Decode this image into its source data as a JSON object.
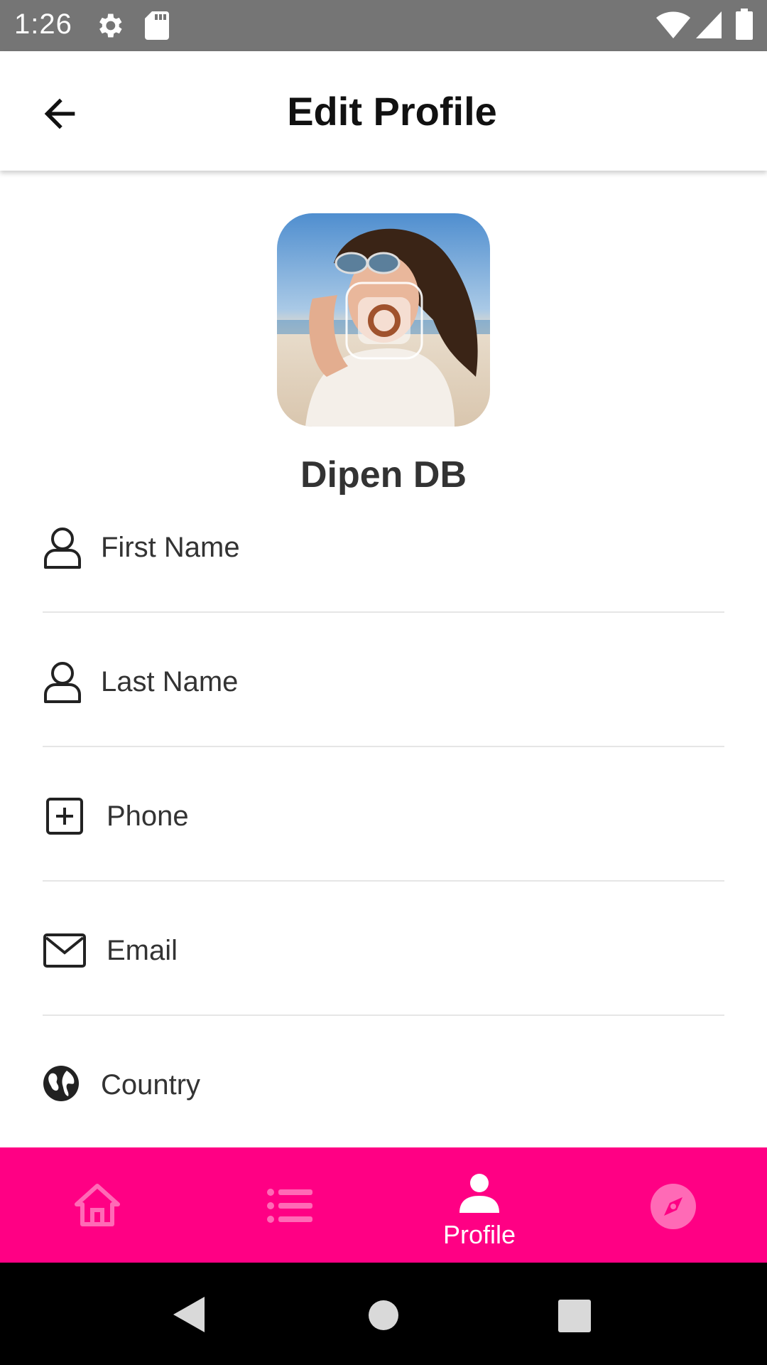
{
  "status_bar": {
    "time": "1:26",
    "icons": [
      "settings-icon",
      "sd-card-icon",
      "wifi-icon",
      "signal-icon",
      "battery-icon"
    ]
  },
  "app_bar": {
    "title": "Edit Profile",
    "back_icon": "arrow-back-icon"
  },
  "profile": {
    "name": "Dipen DB",
    "avatar_overlay_icon": "camera-icon"
  },
  "form": {
    "fields": [
      {
        "label": "First Name",
        "icon": "person-outline-icon"
      },
      {
        "label": "Last Name",
        "icon": "person-outline-icon"
      },
      {
        "label": "Phone",
        "icon": "phone-plus-box-icon"
      },
      {
        "label": "Email",
        "icon": "envelope-icon"
      },
      {
        "label": "Country",
        "icon": "globe-icon"
      }
    ]
  },
  "bottom_nav": {
    "items": [
      {
        "icon": "home-icon",
        "label": ""
      },
      {
        "icon": "list-icon",
        "label": ""
      },
      {
        "icon": "person-icon",
        "label": "Profile",
        "active": true
      },
      {
        "icon": "compass-icon",
        "label": ""
      }
    ]
  },
  "colors": {
    "accent": "#ff0084",
    "inactive_icon": "#ff6ab6",
    "status_bar": "#757575",
    "divider": "#e6e6e6"
  }
}
